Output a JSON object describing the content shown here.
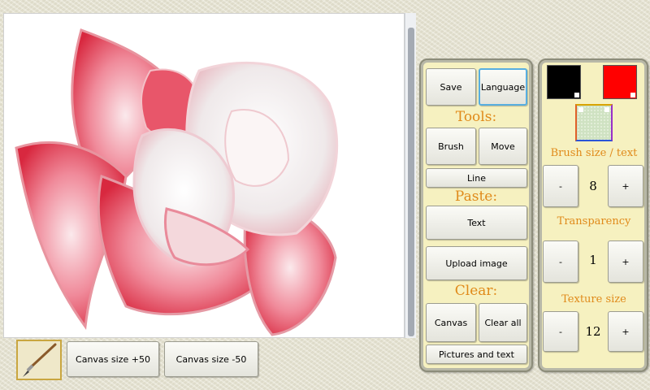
{
  "toolbar": {
    "save": "Save",
    "language": "Language"
  },
  "tools": {
    "heading": "Tools:",
    "brush": "Brush",
    "move": "Move",
    "line": "Line"
  },
  "paste": {
    "heading": "Paste:",
    "text": "Text",
    "upload_image": "Upload image"
  },
  "clear": {
    "heading": "Clear:",
    "canvas": "Canvas",
    "clear_all": "Clear all",
    "pictures_and_text": "Pictures and text"
  },
  "colors": {
    "primary": "#000000",
    "secondary": "#ff0000"
  },
  "brush_size": {
    "label": "Brush size / text",
    "minus": "-",
    "value": "8",
    "plus": "+"
  },
  "transparency": {
    "label": "Transparency",
    "minus": "-",
    "value": "1",
    "plus": "+"
  },
  "texture_size": {
    "label": "Texture size",
    "minus": "-",
    "value": "12",
    "plus": "+"
  },
  "bottom_bar": {
    "canvas_plus": "Canvas size +50",
    "canvas_minus": "Canvas size -50"
  }
}
